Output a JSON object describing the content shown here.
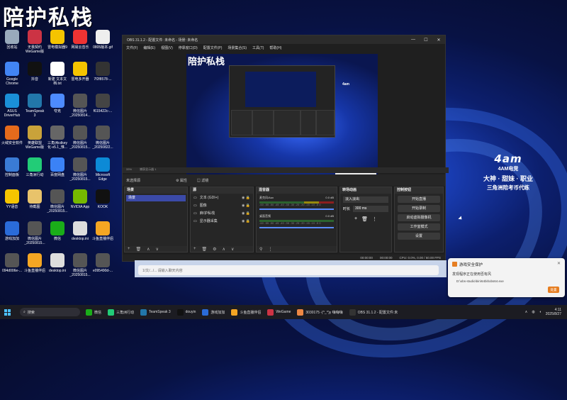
{
  "watermark": "陪护私栈",
  "desktop_icons": [
    {
      "label": "回收站",
      "color": "#9ab"
    },
    {
      "label": "无畏契约WeGame版",
      "color": "#c34"
    },
    {
      "label": "雷电模拟器9",
      "color": "#f5c400"
    },
    {
      "label": "网易云音乐",
      "color": "#e33"
    },
    {
      "label": "0805版本.gif",
      "color": "#eee"
    },
    {
      "label": "Google Chrome",
      "color": "#4285f4"
    },
    {
      "label": "抖音",
      "color": "#111"
    },
    {
      "label": "新建 文本文档.txt",
      "color": "#fff"
    },
    {
      "label": "雷电多开器",
      "color": "#f5c400"
    },
    {
      "label": "7f2f8578-...",
      "color": "#333"
    },
    {
      "label": "ASUS DriverHub",
      "color": "#1a8fd8"
    },
    {
      "label": "TeamSpeak 3",
      "color": "#27a"
    },
    {
      "label": "夸克",
      "color": "#4d8bff"
    },
    {
      "label": "微信图片_20250814...",
      "color": "#555"
    },
    {
      "label": "f615422c-...",
      "color": "#444"
    },
    {
      "label": "火绒安全软件",
      "color": "#e56a1c"
    },
    {
      "label": "英雄联盟WeGame版",
      "color": "#c9a23a"
    },
    {
      "label": "三角洲cdkey化-v5.1_惟...",
      "color": "#666"
    },
    {
      "label": "微信图片_20250815...",
      "color": "#555"
    },
    {
      "label": "微信图片_20250822...",
      "color": "#555"
    },
    {
      "label": "控制面板",
      "color": "#3a7bd5"
    },
    {
      "label": "三角洲行动",
      "color": "#2c7"
    },
    {
      "label": "百度网盘",
      "color": "#3b82f6"
    },
    {
      "label": "微信图片_20250815...",
      "color": "#555"
    },
    {
      "label": "Microsoft Edge",
      "color": "#0c8ad6"
    },
    {
      "label": "YY语音",
      "color": "#f6c500"
    },
    {
      "label": "待截图",
      "color": "#e8c36b"
    },
    {
      "label": "微信图片_20250815...",
      "color": "#555"
    },
    {
      "label": "NVIDIA App",
      "color": "#76b900"
    },
    {
      "label": "KOOK",
      "color": "#111"
    },
    {
      "label": "游戏加加",
      "color": "#2a6bd8"
    },
    {
      "label": "微信图片_20250815...",
      "color": "#555"
    },
    {
      "label": "微信",
      "color": "#1aad19"
    },
    {
      "label": "desktop.ini",
      "color": "#ddd"
    },
    {
      "label": "斗鱼直播伴侣",
      "color": "#f5a623"
    },
    {
      "label": "094d006e-...",
      "color": "#555"
    },
    {
      "label": "斗鱼直播伴侣",
      "color": "#f5a623"
    },
    {
      "label": "desktop.ini",
      "color": "#ddd"
    },
    {
      "label": "微信图片_20250815...",
      "color": "#555"
    },
    {
      "label": "e095490d-...",
      "color": "#555"
    }
  ],
  "obs": {
    "title": "OBS 31.1.2 - 配置文件: 未命名 - 场景: 未命名",
    "menu": [
      "文件(F)",
      "编辑(E)",
      "视图(V)",
      "停靠窗口(D)",
      "配置文件(P)",
      "场景集合(S)",
      "工具(T)",
      "帮助(H)"
    ],
    "toolbar_left": "33%",
    "toolbar_mid": "捕获显示器 1",
    "scenebar_label": "未选择源",
    "scenebar_props": "⚙ 属性",
    "scenebar_filters": "▤ 滤镜",
    "docks": {
      "scenes": {
        "title": "场景",
        "items": [
          "场景"
        ]
      },
      "sources": {
        "title": "源",
        "items": [
          "文本 (GDI+)",
          "图像",
          "麻/护私栈",
          "显示器采集"
        ]
      },
      "mixer": {
        "title": "混音器",
        "tracks": [
          {
            "name": "麦克风/Aux",
            "db": "0.0 dB"
          },
          {
            "name": "桌面音频",
            "db": "0.0 dB"
          }
        ],
        "scale": "-60 -55 -50 -45 -40 -35 -30 -25 -20 -15 -10 -5 0"
      },
      "transitions": {
        "title": "转场动画",
        "type": "淡入淡出",
        "duration_label": "时长",
        "duration": "300 ms"
      },
      "controls": {
        "title": "控制按钮",
        "buttons": [
          "开始直播",
          "开始录制",
          "启动虚拟摄像机",
          "工作室模式",
          "设置"
        ]
      }
    },
    "status": {
      "live": "00:00:00",
      "rec": "00:00:00",
      "cpu": "CPU: 0.0%, 0.00 / 60.00 FPS"
    }
  },
  "logo": {
    "main": "4am",
    "sub": "4AM电竞",
    "line2": "大神 · 甜妹 · 职业",
    "line3": "三角洲陪考币代练"
  },
  "bottom_bar_text": "1/文/.../... 请输入聊天内容",
  "toast": {
    "title": "游戏安全保护",
    "desc": "发现程序正在使用否有风",
    "path": "D:\\obs-studio\\bin\\64bit\\obs64.exe",
    "button": "处置"
  },
  "taskbar": {
    "search": "搜索",
    "items": [
      {
        "label": "微信",
        "color": "#1aad19"
      },
      {
        "label": "三角洲行动",
        "color": "#2c7"
      },
      {
        "label": "TeamSpeak 3",
        "color": "#27a"
      },
      {
        "label": "douyin",
        "color": "#111"
      },
      {
        "label": "游戏加加",
        "color": "#2a6bd8"
      },
      {
        "label": "斗鱼直播伴侣",
        "color": "#f5a623"
      },
      {
        "label": "WeGame",
        "color": "#c34"
      },
      {
        "label": "3030175 -(^_^)y 嗨嗨嗨",
        "color": "#e84"
      },
      {
        "label": "OBS 31.1.2 - 配置文件:未",
        "color": "#333"
      }
    ],
    "time": "4:11",
    "date": "2025/8/27"
  }
}
